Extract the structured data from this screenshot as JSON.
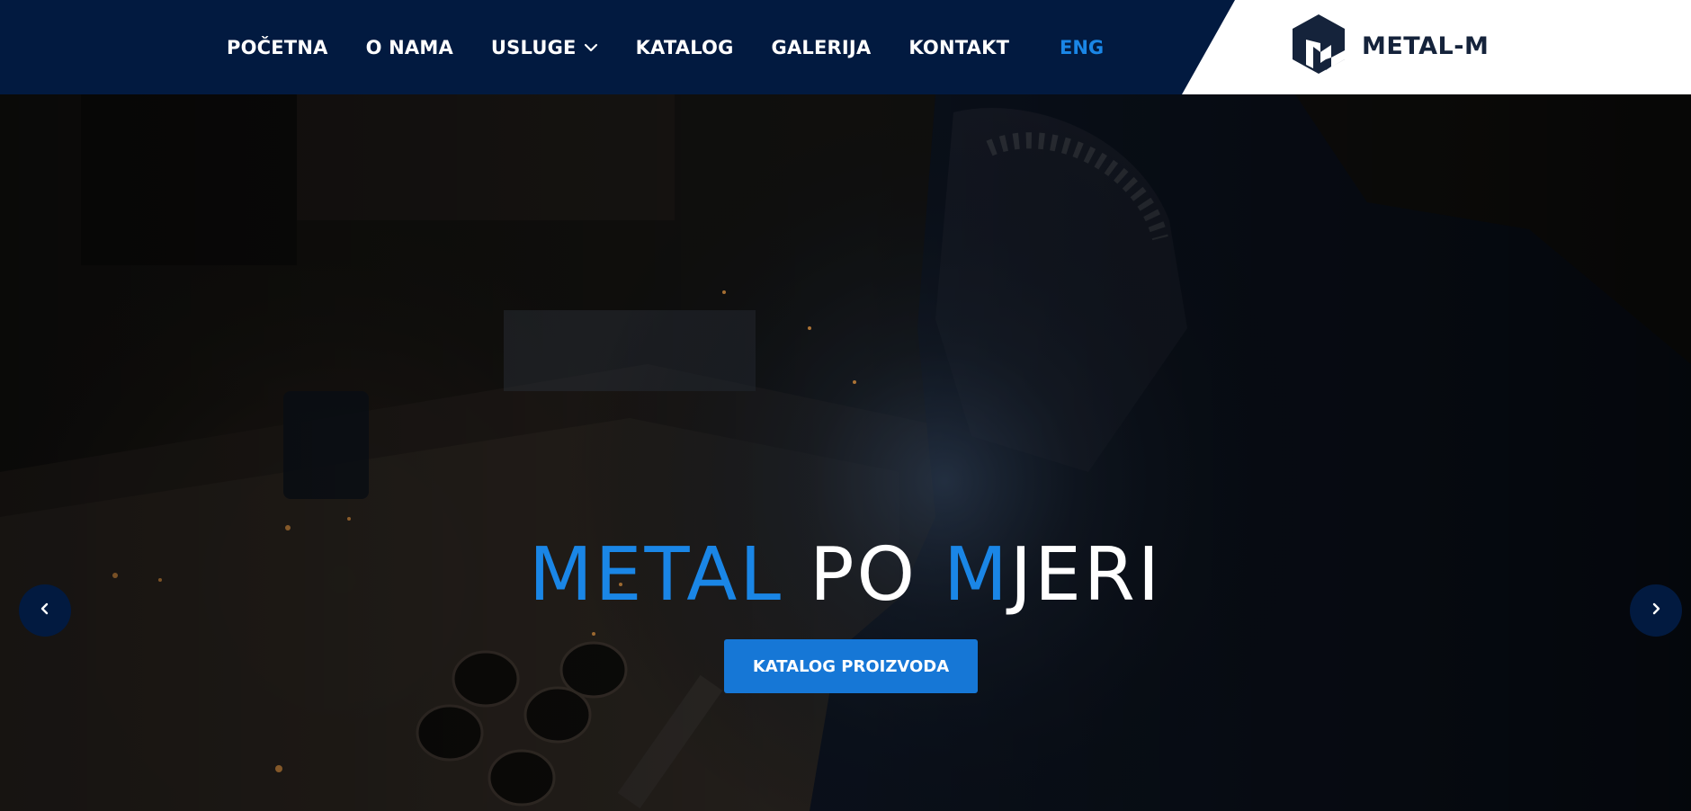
{
  "nav": {
    "items": [
      {
        "label": "POČETNA"
      },
      {
        "label": "O NAMA"
      },
      {
        "label": "USLUGE",
        "has_dropdown": true
      },
      {
        "label": "KATALOG"
      },
      {
        "label": "GALERIJA"
      },
      {
        "label": "KONTAKT"
      }
    ],
    "language": "ENG"
  },
  "logo": {
    "text": "METAL-M",
    "icon": "metal-m-logo-icon"
  },
  "hero": {
    "title_parts": {
      "w1": "METAL",
      "w2": "PO",
      "w3a": "M",
      "w3b": "JERI"
    },
    "cta_label": "KATALOG PROIZVODA",
    "prev_icon": "chevron-left-icon",
    "next_icon": "chevron-right-icon"
  },
  "colors": {
    "header_bg": "#021a40",
    "accent_blue": "#1a86e6",
    "cta_bg": "#1677d6",
    "logo_text": "#15233b"
  }
}
